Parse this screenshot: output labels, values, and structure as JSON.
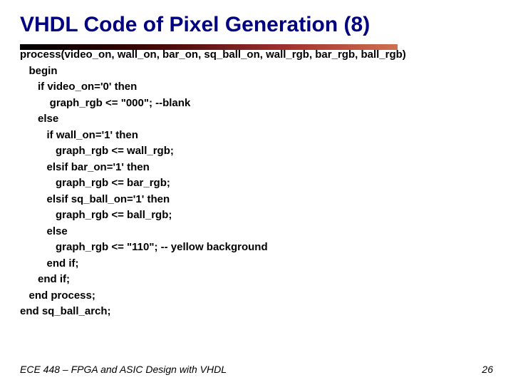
{
  "title": "VHDL Code of Pixel Generation (8)",
  "code": {
    "l0": "process(video_on, wall_on, bar_on, sq_ball_on, wall_rgb, bar_rgb, ball_rgb)",
    "l1": "   begin",
    "l2": "      if video_on='0' then",
    "l3": "          graph_rgb <= \"000\"; --blank",
    "l4": "      else",
    "l5": "         if wall_on='1' then",
    "l6": "            graph_rgb <= wall_rgb;",
    "l7": "         elsif bar_on='1' then",
    "l8": "            graph_rgb <= bar_rgb;",
    "l9": "         elsif sq_ball_on='1' then",
    "l10": "            graph_rgb <= ball_rgb;",
    "l11": "         else",
    "l12": "            graph_rgb <= \"110\"; -- yellow background",
    "l13": "         end if;",
    "l14": "      end if;",
    "l15": "   end process;",
    "l16": "end sq_ball_arch;"
  },
  "footer": {
    "left": "ECE 448 – FPGA and ASIC Design with VHDL",
    "page": "26"
  }
}
